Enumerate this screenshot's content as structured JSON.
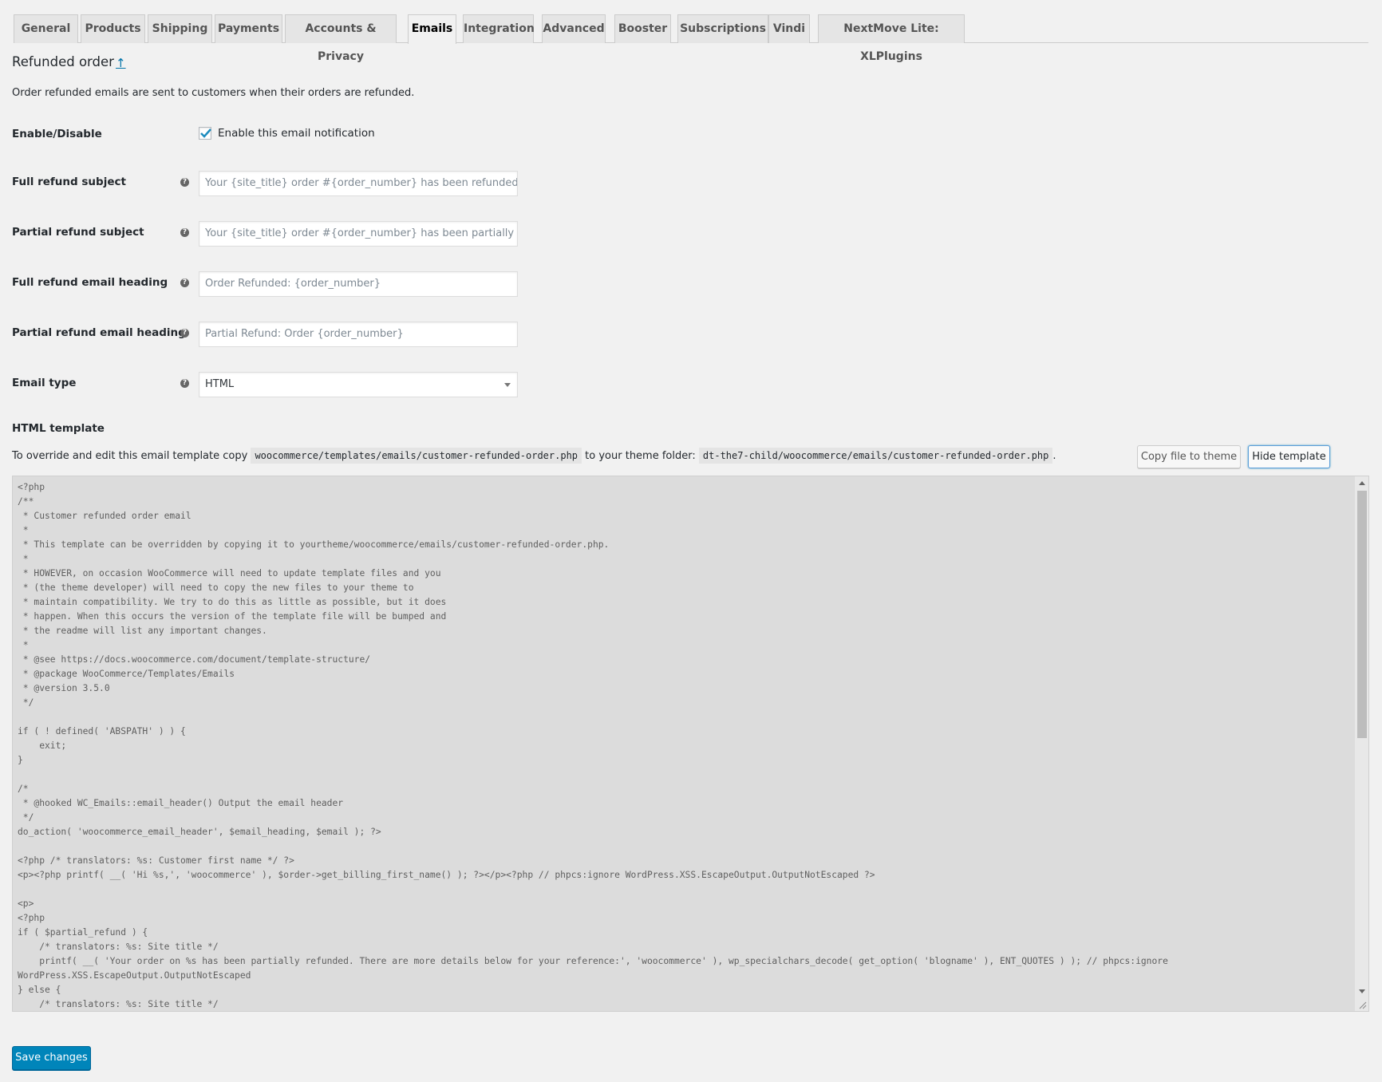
{
  "tabs": [
    {
      "label": "General"
    },
    {
      "label": "Products"
    },
    {
      "label": "Shipping"
    },
    {
      "label": "Payments"
    },
    {
      "label": "Accounts & Privacy"
    },
    {
      "label": "Emails",
      "active": true
    },
    {
      "label": "Integration"
    },
    {
      "label": "Advanced"
    },
    {
      "label": "Booster"
    },
    {
      "label": "Subscriptions"
    },
    {
      "label": "Vindi"
    },
    {
      "label": "NextMove Lite: XLPlugins"
    }
  ],
  "page": {
    "title": "Refunded order",
    "title_link_icon": "↑",
    "description": "Order refunded emails are sent to customers when their orders are refunded."
  },
  "enable": {
    "label": "Enable/Disable",
    "checkbox_label": "Enable this email notification",
    "checked": true
  },
  "fields": {
    "full_subject": {
      "label": "Full refund subject",
      "placeholder": "Your {site_title} order #{order_number} has been refunded"
    },
    "partial_subject": {
      "label": "Partial refund subject",
      "placeholder": "Your {site_title} order #{order_number} has been partially refun"
    },
    "full_heading": {
      "label": "Full refund email heading",
      "placeholder": "Order Refunded: {order_number}"
    },
    "partial_heading": {
      "label": "Partial refund email heading",
      "placeholder": "Partial Refund: Order {order_number}"
    },
    "email_type": {
      "label": "Email type",
      "value": "HTML"
    }
  },
  "template": {
    "heading": "HTML template",
    "text_prefix": "To override and edit this email template copy",
    "source_path": "woocommerce/templates/emails/customer-refunded-order.php",
    "text_middle": "to your theme folder:",
    "dest_path": "dt-the7-child/woocommerce/emails/customer-refunded-order.php",
    "text_suffix": ".",
    "copy_button": "Copy file to theme",
    "hide_button": "Hide template",
    "code": "<?php\n/**\n * Customer refunded order email\n *\n * This template can be overridden by copying it to yourtheme/woocommerce/emails/customer-refunded-order.php.\n *\n * HOWEVER, on occasion WooCommerce will need to update template files and you\n * (the theme developer) will need to copy the new files to your theme to\n * maintain compatibility. We try to do this as little as possible, but it does\n * happen. When this occurs the version of the template file will be bumped and\n * the readme will list any important changes.\n *\n * @see https://docs.woocommerce.com/document/template-structure/\n * @package WooCommerce/Templates/Emails\n * @version 3.5.0\n */\n\nif ( ! defined( 'ABSPATH' ) ) {\n    exit;\n}\n\n/*\n * @hooked WC_Emails::email_header() Output the email header\n */\ndo_action( 'woocommerce_email_header', $email_heading, $email ); ?>\n\n<?php /* translators: %s: Customer first name */ ?>\n<p><?php printf( __( 'Hi %s,', 'woocommerce' ), $order->get_billing_first_name() ); ?></p><?php // phpcs:ignore WordPress.XSS.EscapeOutput.OutputNotEscaped ?>\n\n<p>\n<?php\nif ( $partial_refund ) {\n    /* translators: %s: Site title */\n    printf( __( 'Your order on %s has been partially refunded. There are more details below for your reference:', 'woocommerce' ), wp_specialchars_decode( get_option( 'blogname' ), ENT_QUOTES ) ); // phpcs:ignore\nWordPress.XSS.EscapeOutput.OutputNotEscaped\n} else {\n    /* translators: %s: Site title */"
  },
  "save_button": "Save changes"
}
